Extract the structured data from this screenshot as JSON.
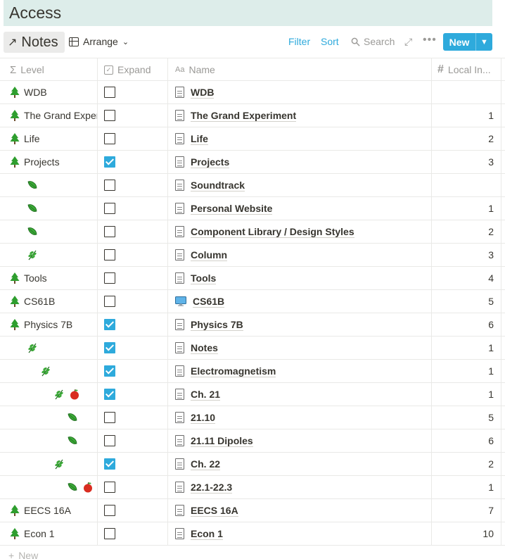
{
  "page": {
    "title": "Access"
  },
  "toolbar": {
    "view_arrow": "↗",
    "view_name": "Notes",
    "arrange_label": "Arrange",
    "filter_label": "Filter",
    "sort_label": "Sort",
    "search_label": "Search",
    "more_label": "•••",
    "new_label": "New"
  },
  "columns": {
    "level": "Level",
    "expand": "Expand",
    "name_prefix": "Aa",
    "name": "Name",
    "local": "Local In..."
  },
  "rows": [
    {
      "level": "WDB",
      "icons": [
        "tree"
      ],
      "indent": 0,
      "expand": false,
      "name": "WDB",
      "page_icon": "doc",
      "local": ""
    },
    {
      "level": "The Grand Experi",
      "icons": [
        "tree"
      ],
      "indent": 0,
      "expand": false,
      "name": "The Grand Experiment",
      "page_icon": "doc",
      "local": "1"
    },
    {
      "level": "Life",
      "icons": [
        "tree"
      ],
      "indent": 0,
      "expand": false,
      "name": "Life",
      "page_icon": "doc",
      "local": "2"
    },
    {
      "level": "Projects",
      "icons": [
        "tree"
      ],
      "indent": 0,
      "expand": true,
      "name": "Projects",
      "page_icon": "doc",
      "local": "3"
    },
    {
      "level": "",
      "icons": [
        "leaf"
      ],
      "indent": 1,
      "expand": false,
      "name": "Soundtrack",
      "page_icon": "doc",
      "local": ""
    },
    {
      "level": "",
      "icons": [
        "leaf"
      ],
      "indent": 1,
      "expand": false,
      "name": "Personal Website",
      "page_icon": "doc",
      "local": "1"
    },
    {
      "level": "",
      "icons": [
        "leaf"
      ],
      "indent": 1,
      "expand": false,
      "name": "Component Library / Design Styles",
      "page_icon": "doc",
      "local": "2"
    },
    {
      "level": "",
      "icons": [
        "herb"
      ],
      "indent": 1,
      "expand": false,
      "name": "Column",
      "page_icon": "doc",
      "local": "3"
    },
    {
      "level": "Tools",
      "icons": [
        "tree"
      ],
      "indent": 0,
      "expand": false,
      "name": "Tools",
      "page_icon": "doc",
      "local": "4"
    },
    {
      "level": "CS61B",
      "icons": [
        "tree"
      ],
      "indent": 0,
      "expand": false,
      "name": "CS61B",
      "page_icon": "monitor",
      "local": "5"
    },
    {
      "level": "Physics 7B",
      "icons": [
        "tree"
      ],
      "indent": 0,
      "expand": true,
      "name": "Physics 7B",
      "page_icon": "doc",
      "local": "6"
    },
    {
      "level": "",
      "icons": [
        "herb"
      ],
      "indent": 1,
      "expand": true,
      "name": "Notes",
      "page_icon": "doc",
      "local": "1"
    },
    {
      "level": "",
      "icons": [
        "herb"
      ],
      "indent": 2,
      "expand": true,
      "name": "Electromagnetism",
      "page_icon": "doc",
      "local": "1"
    },
    {
      "level": "",
      "icons": [
        "herb",
        "apple"
      ],
      "indent": 3,
      "expand": true,
      "name": "Ch. 21",
      "page_icon": "doc",
      "local": "1"
    },
    {
      "level": "",
      "icons": [
        "leaf"
      ],
      "indent": 4,
      "expand": false,
      "name": "21.10",
      "page_icon": "doc",
      "local": "5"
    },
    {
      "level": "",
      "icons": [
        "leaf"
      ],
      "indent": 4,
      "expand": false,
      "name": "21.11 Dipoles",
      "page_icon": "doc",
      "local": "6"
    },
    {
      "level": "",
      "icons": [
        "herb"
      ],
      "indent": 3,
      "expand": true,
      "name": "Ch. 22",
      "page_icon": "doc",
      "local": "2"
    },
    {
      "level": "",
      "icons": [
        "leaf",
        "apple"
      ],
      "indent": 4,
      "expand": false,
      "name": "22.1-22.3",
      "page_icon": "doc",
      "local": "1"
    },
    {
      "level": "EECS 16A",
      "icons": [
        "tree"
      ],
      "indent": 0,
      "expand": false,
      "name": "EECS 16A",
      "page_icon": "doc",
      "local": "7"
    },
    {
      "level": "Econ 1",
      "icons": [
        "tree"
      ],
      "indent": 0,
      "expand": false,
      "name": "Econ 1",
      "page_icon": "doc",
      "local": "10"
    }
  ],
  "footer": {
    "new_label": "New",
    "plus": "+"
  },
  "colors": {
    "accent": "#2eaadc",
    "header_bg": "#ddedea",
    "tree_green": "#2e9e2e",
    "apple_red": "#d92d20"
  }
}
